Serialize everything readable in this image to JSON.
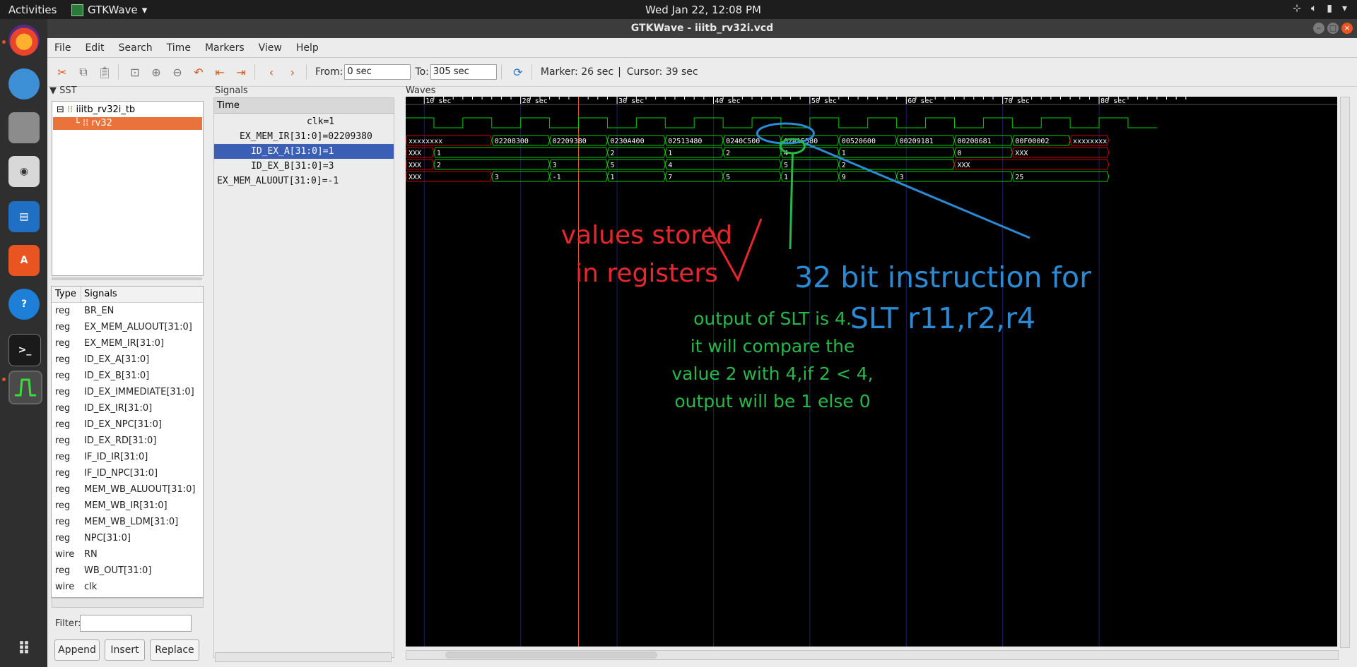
{
  "topbar": {
    "activities": "Activities",
    "app_name": "GTKWave",
    "clock": "Wed Jan 22, 12:08 PM"
  },
  "window": {
    "title": "GTKWave - iiitb_rv32i.vcd"
  },
  "menu": [
    "File",
    "Edit",
    "Search",
    "Time",
    "Markers",
    "View",
    "Help"
  ],
  "toolbar": {
    "from_label": "From:",
    "from_value": "0 sec",
    "to_label": "To:",
    "to_value": "305 sec",
    "marker": "Marker: 26 sec",
    "cursor": "Cursor: 39 sec"
  },
  "sst": {
    "title": "SST",
    "tree": [
      {
        "label": "iiitb_rv32i_tb"
      },
      {
        "label": "rv32"
      }
    ]
  },
  "signal_table": {
    "headers": [
      "Type",
      "Signals"
    ],
    "rows": [
      [
        "reg",
        "BR_EN"
      ],
      [
        "reg",
        "EX_MEM_ALUOUT[31:0]"
      ],
      [
        "reg",
        "EX_MEM_IR[31:0]"
      ],
      [
        "reg",
        "ID_EX_A[31:0]"
      ],
      [
        "reg",
        "ID_EX_B[31:0]"
      ],
      [
        "reg",
        "ID_EX_IMMEDIATE[31:0]"
      ],
      [
        "reg",
        "ID_EX_IR[31:0]"
      ],
      [
        "reg",
        "ID_EX_NPC[31:0]"
      ],
      [
        "reg",
        "ID_EX_RD[31:0]"
      ],
      [
        "reg",
        "IF_ID_IR[31:0]"
      ],
      [
        "reg",
        "IF_ID_NPC[31:0]"
      ],
      [
        "reg",
        "MEM_WB_ALUOUT[31:0]"
      ],
      [
        "reg",
        "MEM_WB_IR[31:0]"
      ],
      [
        "reg",
        "MEM_WB_LDM[31:0]"
      ],
      [
        "reg",
        "NPC[31:0]"
      ],
      [
        "wire",
        "RN"
      ],
      [
        "reg",
        "WB_OUT[31:0]"
      ],
      [
        "wire",
        "clk"
      ]
    ]
  },
  "filter_label": "Filter:",
  "buttons": {
    "append": "Append",
    "insert": "Insert",
    "replace": "Replace"
  },
  "signals_pane": {
    "title": "Signals",
    "time_label": "Time",
    "rows": [
      {
        "text": "clk=1",
        "selected": false
      },
      {
        "text": "EX_MEM_IR[31:0]=02209380",
        "selected": false
      },
      {
        "text": "ID_EX_A[31:0]=1",
        "selected": true
      },
      {
        "text": "ID_EX_B[31:0]=3",
        "selected": false
      },
      {
        "text": "EX_MEM_ALUOUT[31:0]=-1",
        "selected": false
      }
    ]
  },
  "waves": {
    "title": "Waves",
    "time_ticks": [
      "10 sec",
      "20 sec",
      "30 sec",
      "40 sec",
      "50 sec",
      "60 sec",
      "70 sec",
      "80 sec"
    ],
    "buses": [
      {
        "name": "EX_MEM_IR",
        "segments": [
          [
            "xxxxxxxx",
            8,
            17,
            "x"
          ],
          [
            "02208300",
            17,
            23,
            "v"
          ],
          [
            "02209380",
            23,
            29,
            "v"
          ],
          [
            "0230A400",
            29,
            35,
            "v"
          ],
          [
            "02513480",
            35,
            41,
            "v"
          ],
          [
            "0240C500",
            41,
            47,
            "v"
          ],
          [
            "02415580",
            47,
            53,
            "v"
          ],
          [
            "00520600",
            53,
            59,
            "v"
          ],
          [
            "00209181",
            59,
            65,
            "v"
          ],
          [
            "00208681",
            65,
            71,
            "v"
          ],
          [
            "00F00002",
            71,
            77,
            "v"
          ],
          [
            "xxxxxxxx",
            77,
            81,
            "x"
          ]
        ]
      },
      {
        "name": "ID_EX_A",
        "segments": [
          [
            "XXX",
            8,
            11,
            "x"
          ],
          [
            "1",
            11,
            29,
            "v"
          ],
          [
            "2",
            29,
            35,
            "v"
          ],
          [
            "1",
            35,
            41,
            "v"
          ],
          [
            "2",
            41,
            47,
            "v"
          ],
          [
            "4",
            47,
            53,
            "v"
          ],
          [
            "1",
            53,
            65,
            "v"
          ],
          [
            "0",
            65,
            71,
            "v"
          ],
          [
            "XXX",
            71,
            81,
            "x"
          ]
        ]
      },
      {
        "name": "ID_EX_B",
        "segments": [
          [
            "XXX",
            8,
            11,
            "x"
          ],
          [
            "2",
            11,
            23,
            "v"
          ],
          [
            "3",
            23,
            29,
            "v"
          ],
          [
            "5",
            29,
            35,
            "v"
          ],
          [
            "4",
            35,
            47,
            "v"
          ],
          [
            "5",
            47,
            53,
            "v"
          ],
          [
            "2",
            53,
            65,
            "v"
          ],
          [
            "XXX",
            65,
            81,
            "x"
          ]
        ]
      },
      {
        "name": "EX_MEM_ALUOUT",
        "segments": [
          [
            "XXX",
            8,
            17,
            "x"
          ],
          [
            "3",
            17,
            23,
            "v"
          ],
          [
            "-1",
            23,
            29,
            "v"
          ],
          [
            "1",
            29,
            35,
            "v"
          ],
          [
            "7",
            35,
            41,
            "v"
          ],
          [
            "5",
            41,
            47,
            "v"
          ],
          [
            "1",
            47,
            53,
            "v"
          ],
          [
            "9",
            53,
            59,
            "v"
          ],
          [
            "3",
            59,
            71,
            "v"
          ],
          [
            "25",
            71,
            81,
            "v"
          ]
        ]
      }
    ],
    "annotations": {
      "red": [
        "values stored",
        "in registers"
      ],
      "green": [
        "output of SLT is 4.",
        "it will compare the",
        "value 2 with 4,if 2 < 4,",
        "output will be 1 else 0"
      ],
      "blue": [
        "32 bit instruction for",
        "SLT r11,r2,r4"
      ]
    },
    "colors": {
      "bg": "#000000",
      "wave": "#00d000",
      "unknown": "#d00000",
      "text": "#ffffff",
      "grid": "#1f1f5a",
      "cursor": "#e05a2a",
      "ann_red": "#e8262d",
      "ann_green": "#26b84a",
      "ann_blue": "#2a8ad4"
    }
  }
}
